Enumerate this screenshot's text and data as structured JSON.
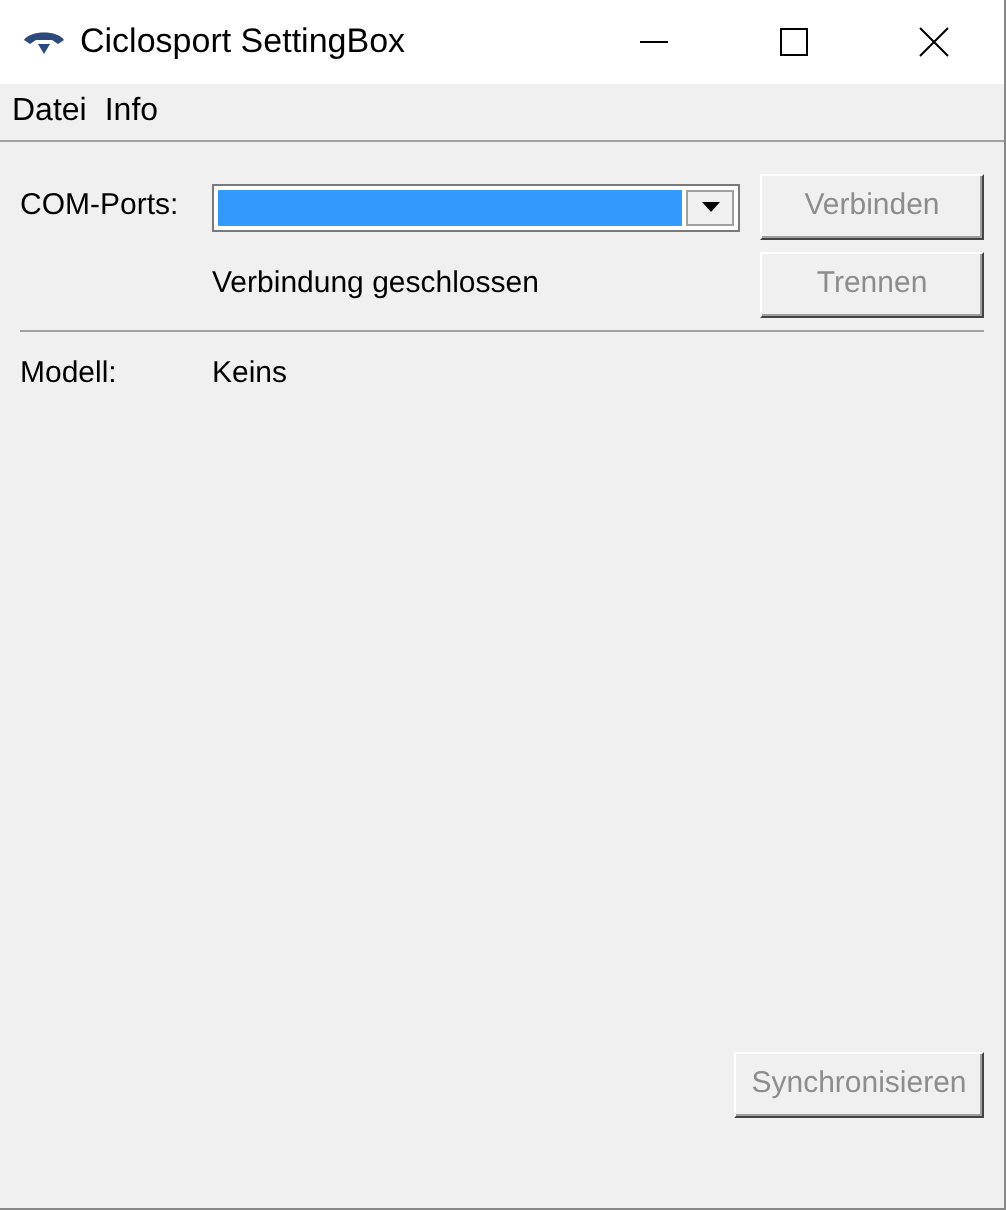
{
  "window": {
    "title": "Ciclosport SettingBox"
  },
  "menu": [
    "Datei",
    "Info"
  ],
  "com_ports": {
    "label": "COM-Ports:",
    "dropdown": {
      "selected": true
    }
  },
  "buttons": [
    {
      "label": "Verbinden",
      "disabled": true
    },
    {
      "label": "Trennen",
      "disabled": true
    }
  ],
  "status": "Verbindung geschlossen",
  "model": {
    "label": "Modell:",
    "value": "Keins"
  },
  "sync_button": {
    "label": "Synchronisieren",
    "disabled": true
  }
}
